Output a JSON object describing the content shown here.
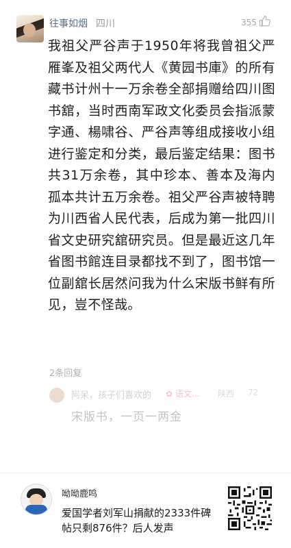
{
  "comment": {
    "user_name": "往事如烟",
    "location": "四川",
    "like_count": "355",
    "body": "我祖父严谷声于1950年将我曾祖父严雁峯及祖父两代人《黄园书庫》的所有藏书计州十一万余卷全部捐赠给四川图书舘，当时西南军政文化委员会指派蒙字通、楊啸谷、严谷声等组成接收小组进行鉴定和分类，最后鉴定结果：图书共31万余卷，其中珍本、善本及海内孤本共计五万余卷。祖父严谷声被特聘为川西省人民代表，后成为第一批四川省文史研究舘研究员。但是最近这几年省图书館连目录都找不到了，图书馆一位副舘长居然问我为什么宋版书鲜有所见，豈不怪哉。",
    "reply_count": "2条回复"
  },
  "reply_preview": {
    "text": "阿呆，孩子们喜欢的",
    "flower_text": "✿ 语文...",
    "location": "陕西",
    "likes": "72",
    "quote": "宋版书，一页一两金"
  },
  "share_card": {
    "author_name": "呦呦鹿鸣",
    "article_title": "爱国学者刘军山捐献的2333件碑帖只剩876件？后人发声"
  }
}
